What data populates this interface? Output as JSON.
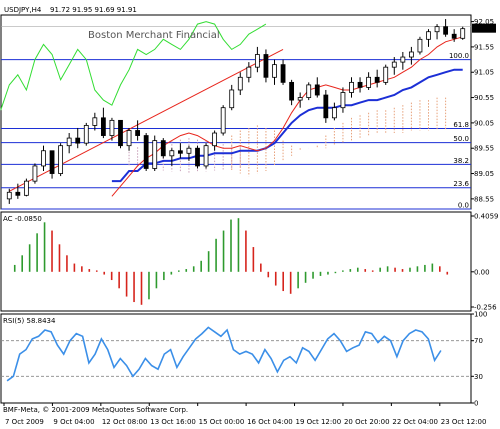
{
  "header": {
    "symbol": "USDJPY,H4",
    "ohlc": "91.72 91.95 91.69 91.91"
  },
  "watermark": "Boston Merchant Financial",
  "copyright": "BMF-Meta, © 2001-2009 MetaQuotes Software Corp.",
  "colors": {
    "bull": "#ffffff",
    "bear": "#000000",
    "tenkan": "#e8251c",
    "kijun": "#1c2fd6",
    "chikou": "#33dd33",
    "cloud": "#e8a27c",
    "cloud_pink": "#c8a0b8",
    "fib": "#1c2fd6",
    "ac_up": "#2e9a2e",
    "ac_down": "#d6241c",
    "rsi": "#3b8fe8"
  },
  "chart_data": [
    {
      "panel": "price",
      "type": "candlestick",
      "title": "USDJPY,H4",
      "y_ticks": [
        "92.05",
        "91.55",
        "91.05",
        "90.55",
        "90.05",
        "89.55",
        "89.05",
        "88.55"
      ],
      "ylim": [
        88.35,
        92.18
      ],
      "last_price": "91.91",
      "fib_levels": [
        {
          "label": "100.0",
          "price": 91.3
        },
        {
          "label": "61.8",
          "price": 89.94
        },
        {
          "label": "50.0",
          "price": 89.66
        },
        {
          "label": "38.2",
          "price": 89.23
        },
        {
          "label": "23.6",
          "price": 88.77
        },
        {
          "label": "0.0",
          "price": 88.35
        }
      ],
      "candles": [
        [
          88.55,
          88.75,
          88.45,
          88.68
        ],
        [
          88.68,
          88.85,
          88.55,
          88.62
        ],
        [
          88.62,
          88.95,
          88.6,
          88.9
        ],
        [
          88.9,
          89.25,
          88.85,
          89.2
        ],
        [
          89.2,
          89.6,
          89.1,
          89.5
        ],
        [
          89.5,
          89.4,
          88.95,
          89.05
        ],
        [
          89.05,
          89.65,
          89.0,
          89.6
        ],
        [
          89.6,
          89.85,
          89.45,
          89.75
        ],
        [
          89.75,
          89.95,
          89.55,
          89.65
        ],
        [
          89.65,
          90.05,
          89.6,
          90.0
        ],
        [
          90.0,
          90.25,
          89.9,
          90.15
        ],
        [
          90.15,
          90.35,
          89.75,
          89.8
        ],
        [
          89.8,
          90.15,
          89.7,
          90.1
        ],
        [
          90.1,
          89.9,
          89.55,
          89.6
        ],
        [
          89.6,
          89.95,
          89.5,
          89.9
        ],
        [
          89.9,
          90.1,
          89.7,
          89.8
        ],
        [
          89.8,
          89.85,
          89.1,
          89.15
        ],
        [
          89.15,
          89.8,
          89.1,
          89.7
        ],
        [
          89.7,
          89.75,
          89.35,
          89.4
        ],
        [
          89.4,
          89.55,
          89.2,
          89.5
        ],
        [
          89.5,
          89.65,
          89.35,
          89.45
        ],
        [
          89.45,
          89.6,
          89.3,
          89.55
        ],
        [
          89.55,
          89.6,
          89.15,
          89.2
        ],
        [
          89.2,
          89.65,
          89.15,
          89.6
        ],
        [
          89.6,
          89.9,
          89.5,
          89.85
        ],
        [
          89.85,
          90.4,
          89.8,
          90.35
        ],
        [
          90.35,
          90.8,
          90.3,
          90.7
        ],
        [
          90.7,
          91.05,
          90.6,
          90.95
        ],
        [
          90.95,
          91.25,
          90.85,
          91.15
        ],
        [
          91.15,
          91.55,
          91.05,
          91.4
        ],
        [
          91.4,
          91.5,
          90.85,
          90.95
        ],
        [
          90.95,
          91.3,
          90.8,
          91.2
        ],
        [
          91.2,
          91.3,
          90.8,
          90.85
        ],
        [
          90.85,
          90.9,
          90.4,
          90.5
        ],
        [
          90.5,
          90.65,
          90.35,
          90.55
        ],
        [
          90.55,
          90.85,
          90.5,
          90.8
        ],
        [
          90.8,
          90.95,
          90.55,
          90.6
        ],
        [
          90.6,
          90.7,
          90.05,
          90.15
        ],
        [
          90.15,
          90.45,
          90.1,
          90.35
        ],
        [
          90.35,
          90.75,
          90.25,
          90.65
        ],
        [
          90.65,
          90.95,
          90.55,
          90.85
        ],
        [
          90.85,
          90.95,
          90.65,
          90.75
        ],
        [
          90.75,
          91.05,
          90.7,
          90.95
        ],
        [
          90.95,
          91.1,
          90.75,
          90.85
        ],
        [
          90.85,
          91.2,
          90.8,
          91.15
        ],
        [
          91.15,
          91.35,
          91.0,
          91.25
        ],
        [
          91.25,
          91.45,
          91.1,
          91.35
        ],
        [
          91.35,
          91.55,
          91.2,
          91.45
        ],
        [
          91.45,
          91.75,
          91.4,
          91.7
        ],
        [
          91.7,
          91.9,
          91.55,
          91.85
        ],
        [
          91.85,
          92.0,
          91.7,
          91.95
        ],
        [
          91.95,
          92.1,
          91.75,
          91.8
        ],
        [
          91.8,
          91.9,
          91.65,
          91.72
        ],
        [
          91.72,
          91.95,
          91.69,
          91.91
        ]
      ],
      "tenkan": [
        88.6,
        88.8,
        89.0,
        89.2,
        89.35,
        89.45,
        89.6,
        89.7,
        89.8,
        89.85,
        89.8,
        89.7,
        89.6,
        89.55,
        89.55,
        89.6,
        89.55,
        89.5,
        89.55,
        89.7,
        89.95,
        90.25,
        90.5,
        90.7,
        90.75,
        90.8,
        90.75,
        90.7,
        90.7,
        90.75,
        90.8,
        90.85,
        90.9,
        90.95,
        91.05,
        91.15,
        91.3,
        91.4,
        91.55,
        91.65,
        91.7,
        91.75
      ],
      "kijun": [
        88.9,
        88.9,
        89.1,
        89.1,
        89.25,
        89.25,
        89.3,
        89.3,
        89.35,
        89.35,
        89.4,
        89.4,
        89.45,
        89.45,
        89.45,
        89.5,
        89.5,
        89.5,
        89.55,
        89.65,
        89.85,
        90.05,
        90.2,
        90.3,
        90.35,
        90.35,
        90.35,
        90.4,
        90.4,
        90.45,
        90.5,
        90.5,
        90.55,
        90.6,
        90.7,
        90.75,
        90.85,
        90.95,
        91.0,
        91.05,
        91.1,
        91.1
      ],
      "cloud_upper": [
        89.8,
        89.9,
        89.95,
        90.0,
        89.95,
        89.9,
        89.7,
        89.6,
        89.55,
        89.55,
        89.6,
        89.8,
        89.95,
        90.05,
        90.15,
        90.2,
        90.25,
        90.3,
        90.3,
        90.35,
        90.4,
        90.45,
        90.5,
        90.5,
        90.55,
        90.55
      ],
      "cloud_lower": [
        89.1,
        89.05,
        89.0,
        89.05,
        89.1,
        89.2,
        89.3,
        89.4,
        89.5,
        89.55,
        89.55,
        89.55,
        89.6,
        89.65,
        89.7,
        89.75,
        89.8,
        89.85,
        89.85,
        89.85,
        89.85,
        89.9,
        89.9,
        89.9,
        89.9,
        89.9
      ],
      "chikou": [
        90.3,
        90.8,
        91.0,
        90.7,
        91.3,
        91.6,
        91.4,
        90.9,
        91.2,
        91.5,
        91.3,
        90.7,
        90.5,
        90.4,
        90.8,
        91.1,
        91.5,
        91.4,
        91.5,
        91.7,
        91.6,
        91.5,
        91.7,
        92.0,
        92.05,
        92.0,
        91.7,
        91.5,
        91.6,
        91.8,
        91.9,
        92.0
      ]
    },
    {
      "panel": "ac",
      "type": "bar",
      "title": "AC -0.0850",
      "y_ticks": [
        "0.4059",
        "0.00",
        "-0.256"
      ],
      "ylim": [
        -0.256,
        0.4059
      ],
      "values": [
        0.05,
        0.12,
        0.2,
        0.28,
        0.36,
        0.3,
        0.2,
        0.12,
        0.06,
        0.04,
        0.02,
        0.01,
        -0.02,
        -0.06,
        -0.12,
        -0.18,
        -0.22,
        -0.24,
        -0.2,
        -0.12,
        -0.06,
        -0.02,
        0.01,
        0.02,
        0.04,
        0.08,
        0.15,
        0.24,
        0.3,
        0.38,
        0.39,
        0.3,
        0.18,
        0.06,
        -0.04,
        -0.1,
        -0.14,
        -0.16,
        -0.12,
        -0.08,
        -0.05,
        -0.03,
        -0.02,
        -0.01,
        0.01,
        0.02,
        0.03,
        0.02,
        0.01,
        0.03,
        0.04,
        0.03,
        0.02,
        0.03,
        0.04,
        0.05,
        0.06,
        0.04,
        -0.02
      ]
    },
    {
      "panel": "rsi",
      "type": "line",
      "title": "RSI(5) 58.8434",
      "y_ticks": [
        "100",
        "70",
        "30",
        "0"
      ],
      "ylim": [
        0,
        100
      ],
      "values": [
        25,
        30,
        55,
        60,
        72,
        75,
        82,
        80,
        65,
        55,
        70,
        78,
        75,
        45,
        55,
        72,
        60,
        40,
        50,
        42,
        30,
        38,
        50,
        42,
        38,
        55,
        60,
        40,
        52,
        62,
        72,
        78,
        85,
        80,
        75,
        82,
        60,
        55,
        58,
        55,
        45,
        60,
        50,
        35,
        48,
        52,
        45,
        62,
        58,
        48,
        60,
        72,
        78,
        70,
        58,
        62,
        65,
        80,
        78,
        68,
        75,
        70,
        52,
        70,
        78,
        82,
        80,
        72,
        48,
        59
      ]
    }
  ],
  "time_labels": [
    "7 Oct 2009",
    "9 Oct 04:00",
    "12 Oct 08:00",
    "13 Oct 16:00",
    "15 Oct 00:00",
    "16 Oct 04:00",
    "19 Oct 12:00",
    "20 Oct 20:00",
    "22 Oct 04:00",
    "23 Oct 12:00"
  ]
}
